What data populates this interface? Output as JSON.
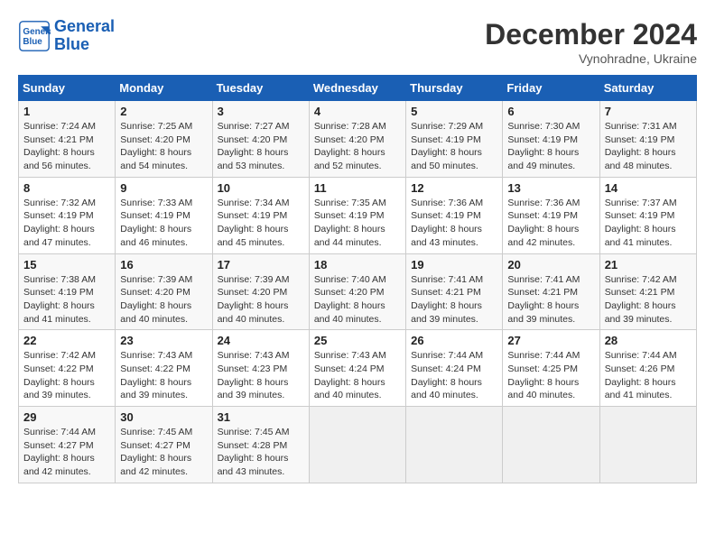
{
  "header": {
    "logo_line1": "General",
    "logo_line2": "Blue",
    "month_year": "December 2024",
    "location": "Vynohradne, Ukraine"
  },
  "weekdays": [
    "Sunday",
    "Monday",
    "Tuesday",
    "Wednesday",
    "Thursday",
    "Friday",
    "Saturday"
  ],
  "weeks": [
    [
      {
        "day": "1",
        "sunrise": "Sunrise: 7:24 AM",
        "sunset": "Sunset: 4:21 PM",
        "daylight": "Daylight: 8 hours and 56 minutes."
      },
      {
        "day": "2",
        "sunrise": "Sunrise: 7:25 AM",
        "sunset": "Sunset: 4:20 PM",
        "daylight": "Daylight: 8 hours and 54 minutes."
      },
      {
        "day": "3",
        "sunrise": "Sunrise: 7:27 AM",
        "sunset": "Sunset: 4:20 PM",
        "daylight": "Daylight: 8 hours and 53 minutes."
      },
      {
        "day": "4",
        "sunrise": "Sunrise: 7:28 AM",
        "sunset": "Sunset: 4:20 PM",
        "daylight": "Daylight: 8 hours and 52 minutes."
      },
      {
        "day": "5",
        "sunrise": "Sunrise: 7:29 AM",
        "sunset": "Sunset: 4:19 PM",
        "daylight": "Daylight: 8 hours and 50 minutes."
      },
      {
        "day": "6",
        "sunrise": "Sunrise: 7:30 AM",
        "sunset": "Sunset: 4:19 PM",
        "daylight": "Daylight: 8 hours and 49 minutes."
      },
      {
        "day": "7",
        "sunrise": "Sunrise: 7:31 AM",
        "sunset": "Sunset: 4:19 PM",
        "daylight": "Daylight: 8 hours and 48 minutes."
      }
    ],
    [
      {
        "day": "8",
        "sunrise": "Sunrise: 7:32 AM",
        "sunset": "Sunset: 4:19 PM",
        "daylight": "Daylight: 8 hours and 47 minutes."
      },
      {
        "day": "9",
        "sunrise": "Sunrise: 7:33 AM",
        "sunset": "Sunset: 4:19 PM",
        "daylight": "Daylight: 8 hours and 46 minutes."
      },
      {
        "day": "10",
        "sunrise": "Sunrise: 7:34 AM",
        "sunset": "Sunset: 4:19 PM",
        "daylight": "Daylight: 8 hours and 45 minutes."
      },
      {
        "day": "11",
        "sunrise": "Sunrise: 7:35 AM",
        "sunset": "Sunset: 4:19 PM",
        "daylight": "Daylight: 8 hours and 44 minutes."
      },
      {
        "day": "12",
        "sunrise": "Sunrise: 7:36 AM",
        "sunset": "Sunset: 4:19 PM",
        "daylight": "Daylight: 8 hours and 43 minutes."
      },
      {
        "day": "13",
        "sunrise": "Sunrise: 7:36 AM",
        "sunset": "Sunset: 4:19 PM",
        "daylight": "Daylight: 8 hours and 42 minutes."
      },
      {
        "day": "14",
        "sunrise": "Sunrise: 7:37 AM",
        "sunset": "Sunset: 4:19 PM",
        "daylight": "Daylight: 8 hours and 41 minutes."
      }
    ],
    [
      {
        "day": "15",
        "sunrise": "Sunrise: 7:38 AM",
        "sunset": "Sunset: 4:19 PM",
        "daylight": "Daylight: 8 hours and 41 minutes."
      },
      {
        "day": "16",
        "sunrise": "Sunrise: 7:39 AM",
        "sunset": "Sunset: 4:20 PM",
        "daylight": "Daylight: 8 hours and 40 minutes."
      },
      {
        "day": "17",
        "sunrise": "Sunrise: 7:39 AM",
        "sunset": "Sunset: 4:20 PM",
        "daylight": "Daylight: 8 hours and 40 minutes."
      },
      {
        "day": "18",
        "sunrise": "Sunrise: 7:40 AM",
        "sunset": "Sunset: 4:20 PM",
        "daylight": "Daylight: 8 hours and 40 minutes."
      },
      {
        "day": "19",
        "sunrise": "Sunrise: 7:41 AM",
        "sunset": "Sunset: 4:21 PM",
        "daylight": "Daylight: 8 hours and 39 minutes."
      },
      {
        "day": "20",
        "sunrise": "Sunrise: 7:41 AM",
        "sunset": "Sunset: 4:21 PM",
        "daylight": "Daylight: 8 hours and 39 minutes."
      },
      {
        "day": "21",
        "sunrise": "Sunrise: 7:42 AM",
        "sunset": "Sunset: 4:21 PM",
        "daylight": "Daylight: 8 hours and 39 minutes."
      }
    ],
    [
      {
        "day": "22",
        "sunrise": "Sunrise: 7:42 AM",
        "sunset": "Sunset: 4:22 PM",
        "daylight": "Daylight: 8 hours and 39 minutes."
      },
      {
        "day": "23",
        "sunrise": "Sunrise: 7:43 AM",
        "sunset": "Sunset: 4:22 PM",
        "daylight": "Daylight: 8 hours and 39 minutes."
      },
      {
        "day": "24",
        "sunrise": "Sunrise: 7:43 AM",
        "sunset": "Sunset: 4:23 PM",
        "daylight": "Daylight: 8 hours and 39 minutes."
      },
      {
        "day": "25",
        "sunrise": "Sunrise: 7:43 AM",
        "sunset": "Sunset: 4:24 PM",
        "daylight": "Daylight: 8 hours and 40 minutes."
      },
      {
        "day": "26",
        "sunrise": "Sunrise: 7:44 AM",
        "sunset": "Sunset: 4:24 PM",
        "daylight": "Daylight: 8 hours and 40 minutes."
      },
      {
        "day": "27",
        "sunrise": "Sunrise: 7:44 AM",
        "sunset": "Sunset: 4:25 PM",
        "daylight": "Daylight: 8 hours and 40 minutes."
      },
      {
        "day": "28",
        "sunrise": "Sunrise: 7:44 AM",
        "sunset": "Sunset: 4:26 PM",
        "daylight": "Daylight: 8 hours and 41 minutes."
      }
    ],
    [
      {
        "day": "29",
        "sunrise": "Sunrise: 7:44 AM",
        "sunset": "Sunset: 4:27 PM",
        "daylight": "Daylight: 8 hours and 42 minutes."
      },
      {
        "day": "30",
        "sunrise": "Sunrise: 7:45 AM",
        "sunset": "Sunset: 4:27 PM",
        "daylight": "Daylight: 8 hours and 42 minutes."
      },
      {
        "day": "31",
        "sunrise": "Sunrise: 7:45 AM",
        "sunset": "Sunset: 4:28 PM",
        "daylight": "Daylight: 8 hours and 43 minutes."
      },
      null,
      null,
      null,
      null
    ]
  ]
}
